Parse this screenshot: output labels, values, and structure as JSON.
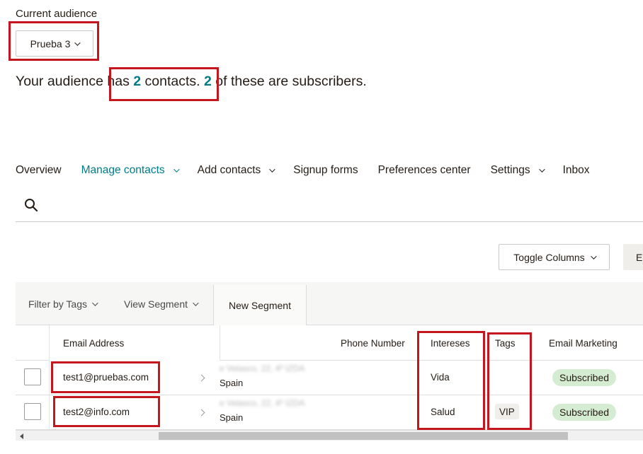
{
  "header": {
    "current_audience_label": "Current audience",
    "audience_selected": "Prueba 3"
  },
  "summary": {
    "part1": "Your audience has ",
    "contacts_count": "2",
    "part2": " contacts. ",
    "subscribers_count": "2",
    "part3": " of these are subscribers."
  },
  "nav": {
    "items": [
      {
        "label": "Overview"
      },
      {
        "label": "Manage contacts"
      },
      {
        "label": "Add contacts"
      },
      {
        "label": "Signup forms"
      },
      {
        "label": "Preferences center"
      },
      {
        "label": "Settings"
      },
      {
        "label": "Inbox"
      }
    ]
  },
  "toolbar": {
    "toggle_columns": "Toggle Columns",
    "export": "E"
  },
  "filters": {
    "filter_by_tags": "Filter by Tags",
    "view_segment": "View Segment",
    "new_segment": "New Segment"
  },
  "table": {
    "columns": {
      "email": "Email Address",
      "phone": "Phone Number",
      "intereses": "Intereses",
      "tags": "Tags",
      "email_marketing": "Email Marketing"
    },
    "rows": [
      {
        "email": "test1@pruebas.com",
        "address_line1": "e Velasco, 22, 4º IZDA",
        "address_line2": "Spain",
        "intereses": "Vida",
        "tag": "",
        "status": "Subscribed"
      },
      {
        "email": "test2@info.com",
        "address_line1": "e Velasco, 22, 4º IZDA",
        "address_line2": "Spain",
        "intereses": "Salud",
        "tag": "VIP",
        "status": "Subscribed"
      }
    ]
  },
  "colors": {
    "accent": "#007c89",
    "highlight": "#c4161c",
    "subscribed_bg": "#d4ecd1"
  },
  "icons": {
    "search": "search-icon",
    "dropdown": "chevron-down-icon",
    "row_open": "chevron-right-icon"
  }
}
